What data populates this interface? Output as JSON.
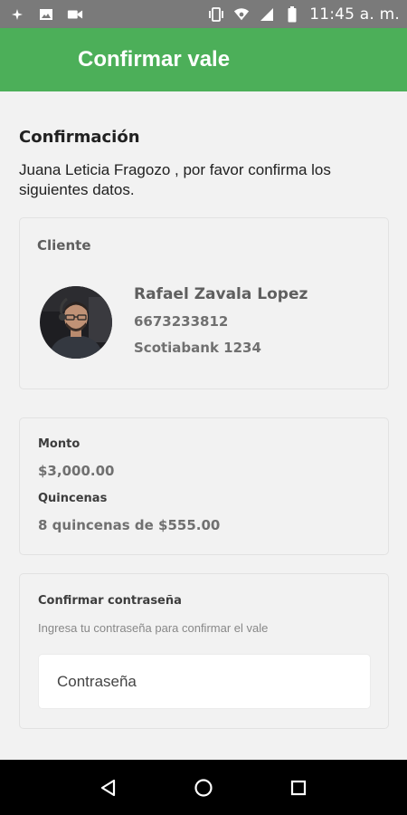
{
  "status_bar": {
    "time": "11:45 a. m.",
    "icons": [
      "cast-icon",
      "image-icon",
      "video-icon",
      "vibrate-icon",
      "wifi-icon",
      "signal-icon",
      "battery-icon"
    ]
  },
  "app_bar": {
    "title": "Confirmar vale",
    "color": "#4caf59"
  },
  "main": {
    "section_title": "Confirmación",
    "intro": "Juana Leticia Fragozo , por favor confirma los siguientes datos.",
    "client_card": {
      "heading": "Cliente",
      "name": "Rafael Zavala Lopez",
      "phone": "6673233812",
      "bank": "Scotiabank 1234"
    },
    "amount_card": {
      "monto_label": "Monto",
      "monto_value": "$3,000.00",
      "quincenas_label": "Quincenas",
      "quincenas_value": "8 quincenas de $555.00"
    },
    "password_card": {
      "title": "Confirmar contraseña",
      "help": "Ingresa tu contraseña para confirmar el vale",
      "placeholder": "Contraseña"
    }
  },
  "nav_bar": {
    "buttons": [
      "back-icon",
      "home-icon",
      "recents-icon"
    ]
  }
}
